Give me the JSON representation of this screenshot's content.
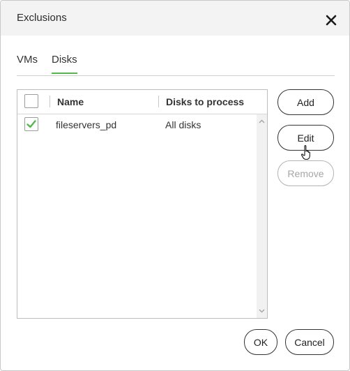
{
  "dialog": {
    "title": "Exclusions"
  },
  "tabs": [
    {
      "label": "VMs",
      "active": false
    },
    {
      "label": "Disks",
      "active": true
    }
  ],
  "grid": {
    "columns": [
      "Name",
      "Disks to process"
    ],
    "rows": [
      {
        "checked": true,
        "name": "fileservers_pd",
        "disks": "All disks"
      }
    ]
  },
  "side_buttons": {
    "add": "Add",
    "edit": "Edit",
    "remove": "Remove",
    "remove_disabled": true
  },
  "footer": {
    "ok": "OK",
    "cancel": "Cancel"
  },
  "colors": {
    "accent_green": "#54b948",
    "border_dark": "#333333",
    "disabled": "#b3b3b3"
  },
  "icons": {
    "close": "close-icon",
    "check": "checkmark-icon",
    "cursor": "hand-pointer-icon"
  }
}
